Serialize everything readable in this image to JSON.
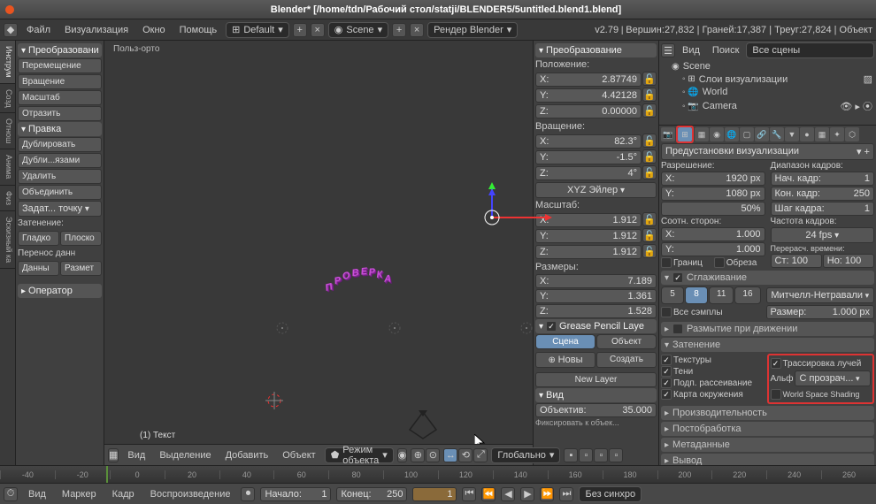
{
  "titlebar": {
    "title": "Blender* [/home/tdn/Рабочий стол/statji/BLENDER5/5untitled.blend1.blend]"
  },
  "top_menu": {
    "file": "Файл",
    "render": "Визуализация",
    "window": "Окно",
    "help": "Помощь"
  },
  "top": {
    "layout": "Default",
    "scene": "Scene",
    "engine": "Рендер Blender",
    "version": "v2.79",
    "stats": "Вершин:27,832 | Граней:17,387 | Треуг:27,824 | Объект"
  },
  "tabs": {
    "tools": "Инструм",
    "create": "Созд",
    "relations": "Отнош",
    "anim": "Анима",
    "physics": "Физ",
    "grease": "Эскизный ка"
  },
  "tool_shelf": {
    "transform": "Преобразовани",
    "translate": "Перемещение",
    "rotate": "Вращение",
    "scale": "Масштаб",
    "mirror": "Отразить",
    "edit": "Правка",
    "duplicate": "Дублировать",
    "dup_linked": "Дубли...язами",
    "delete": "Удалить",
    "join": "Объединить",
    "origin": "Задат... точку",
    "shading": "Затенение:",
    "smooth": "Гладко",
    "flat": "Плоско",
    "data_transfer": "Перенос данн",
    "data": "Данны",
    "layout": "Размет",
    "operator": "Оператор"
  },
  "viewport": {
    "info": "Польз-орто",
    "obj": "(1) Текст",
    "text3d": "ПРОВЕРКА"
  },
  "vp_header": {
    "view": "Вид",
    "select": "Выделение",
    "add": "Добавить",
    "object": "Объект",
    "mode": "Режим объекта",
    "orientation": "Глобально"
  },
  "n_panel": {
    "transform": "Преобразование",
    "location": "Положение:",
    "loc_x": "2.87749",
    "loc_y": "4.42128",
    "loc_z": "0.00000",
    "rotation": "Вращение:",
    "rot_x": "82.3°",
    "rot_y": "-1.5°",
    "rot_z": "4°",
    "euler": "XYZ Эйлер",
    "scale": "Масштаб:",
    "scl_x": "1.912",
    "scl_y": "1.912",
    "scl_z": "1.912",
    "dimensions": "Размеры:",
    "dim_x": "7.189",
    "dim_y": "1.361",
    "dim_z": "1.528",
    "gpencil": "Grease Pencil Laye",
    "scene_btn": "Сцена",
    "object_btn": "Объект",
    "new": "Новы",
    "create": "Создать",
    "newlayer": "New Layer",
    "view": "Вид",
    "lens": "Объектив:",
    "lens_val": "35.000",
    "lock_msg": "Фиксировать к объек..."
  },
  "outliner": {
    "view": "Вид",
    "search": "Поиск",
    "all_scenes": "Все сцены",
    "scene": "Scene",
    "render_layers": "Слои визуализации",
    "world": "World",
    "camera": "Camera"
  },
  "render": {
    "presets": "Предустановки визуализации",
    "resolution": "Разрешение:",
    "res_x": "1920 px",
    "res_y": "1080 px",
    "res_pct": "50%",
    "frame_range": "Диапазон кадров:",
    "start_f": "Нач. кадр:",
    "start_v": "1",
    "end_f": "Кон. кадр:",
    "end_v": "250",
    "step_f": "Шаг кадра:",
    "step_v": "1",
    "aspect": "Соотн. сторон:",
    "asp_x": "1.000",
    "asp_y": "1.000",
    "fps_label": "Частота кадров:",
    "fps": "24 fps",
    "time_remap": "Перерасч. времени:",
    "old": "Ст: 100",
    "new": "Но: 100",
    "border": "Границ",
    "crop": "Обреза",
    "aa": "Сглаживание",
    "aa_5": "5",
    "aa_8": "8",
    "aa_11": "11",
    "aa_16": "16",
    "aa_filter": "Митчелл-Нетравали",
    "full_sample": "Все сэмплы",
    "size": "Размер:",
    "size_v": "1.000 px",
    "mblur": "Размытие при движении",
    "shading": "Затенение",
    "textures": "Текстуры",
    "raytrace": "Трассировка лучей",
    "shadows": "Тени",
    "alpha": "Альф",
    "alpha_mode": "С прозрач...",
    "sss": "Подп. рассеивание",
    "wss": "World Space Shading",
    "envmap": "Карта окружения",
    "perf": "Производительность",
    "post": "Постобработка",
    "meta": "Метаданные",
    "output": "Вывод"
  },
  "timeline": {
    "ticks": [
      "-40",
      "-20",
      "0",
      "20",
      "40",
      "60",
      "80",
      "100",
      "120",
      "140",
      "160",
      "180",
      "200",
      "220",
      "240",
      "260"
    ],
    "view": "Вид",
    "marker": "Маркер",
    "frame": "Кадр",
    "playback": "Воспроизведение",
    "start": "Начало:",
    "start_v": "1",
    "end": "Конец:",
    "end_v": "250",
    "sync": "Без синхро"
  }
}
